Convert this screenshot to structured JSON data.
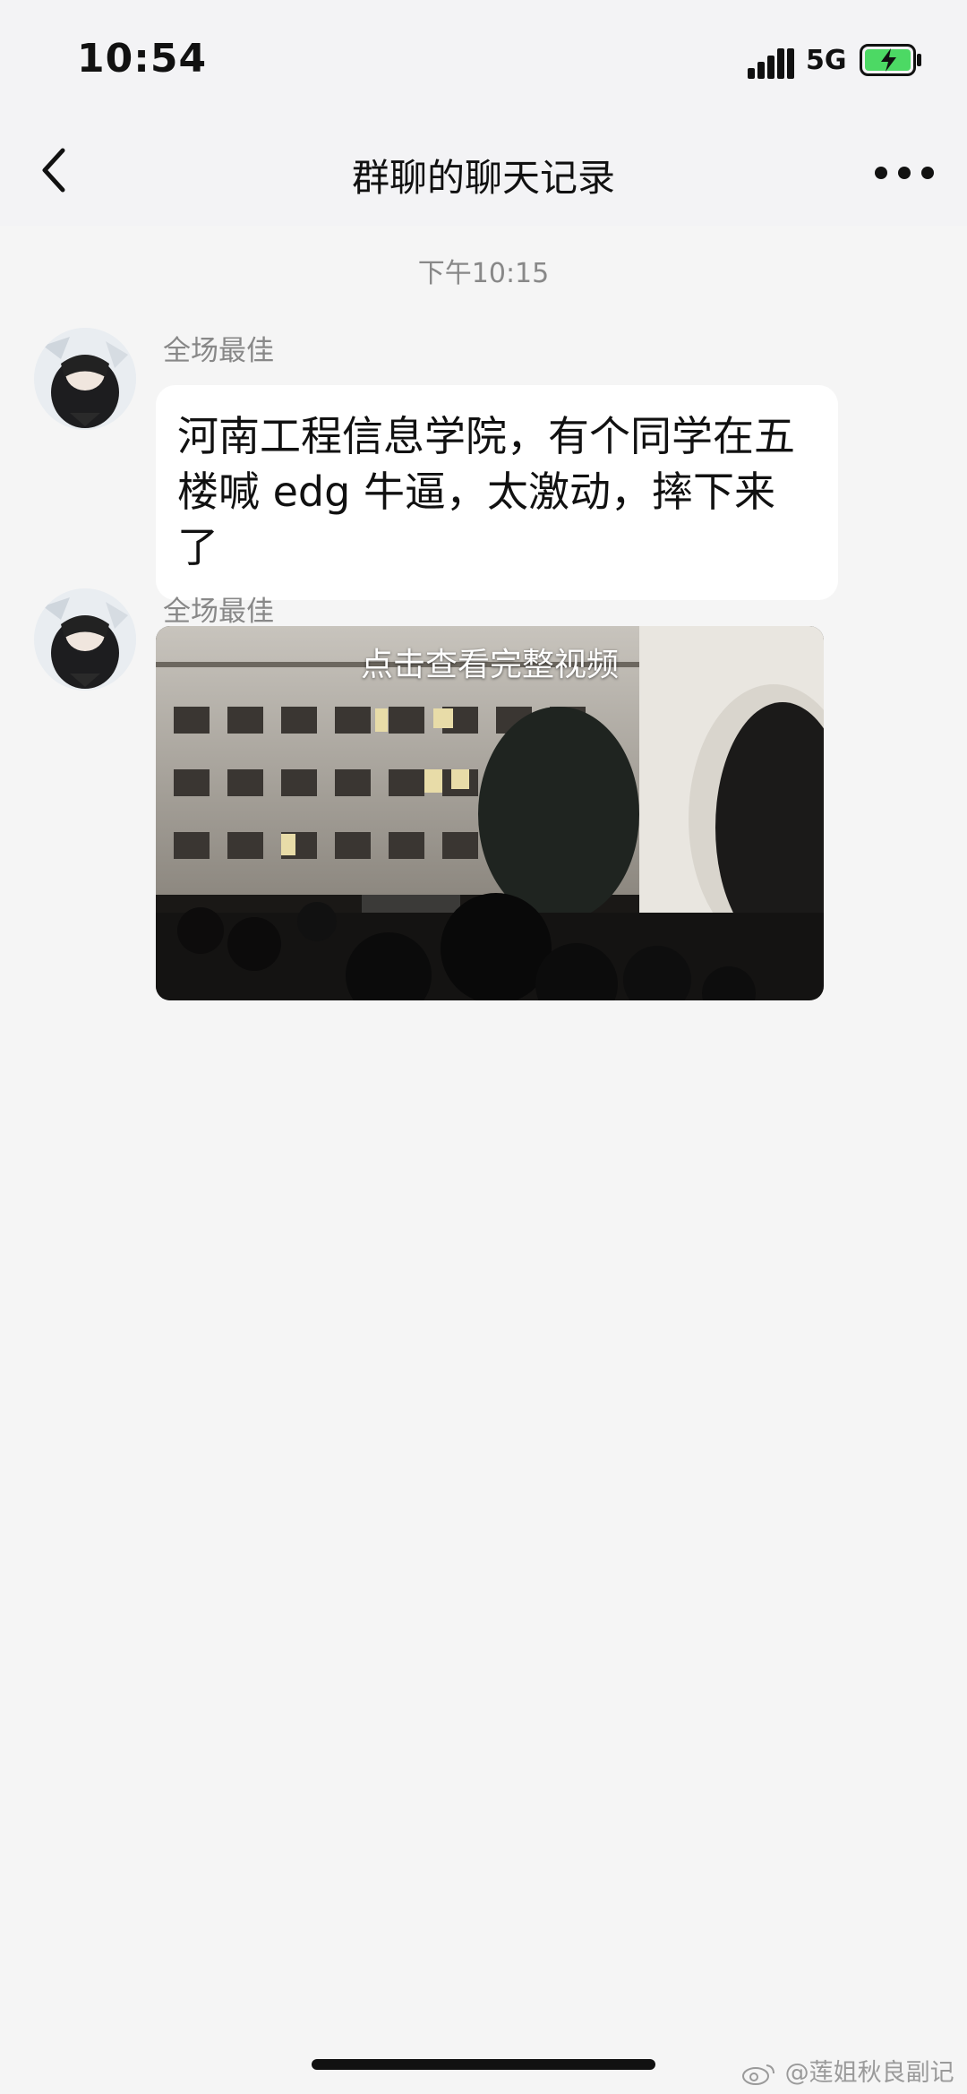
{
  "status_bar": {
    "time": "10:54",
    "network": "5G",
    "battery_charging": true,
    "battery_color": "#4cd964"
  },
  "header": {
    "title": "群聊的聊天记录",
    "back_icon": "chevron-left-icon",
    "more_icon": "more-dots-icon"
  },
  "chat": {
    "timestamp": "下午10:15",
    "messages": [
      {
        "sender": "全场最佳",
        "text": "河南工程信息学院，有个同学在五楼喊 edg 牛逼，太激动，摔下来了"
      },
      {
        "sender": "全场最佳",
        "video_caption": "点击查看完整视频"
      }
    ]
  },
  "watermark": {
    "text": "@莲姐秋良副记"
  }
}
